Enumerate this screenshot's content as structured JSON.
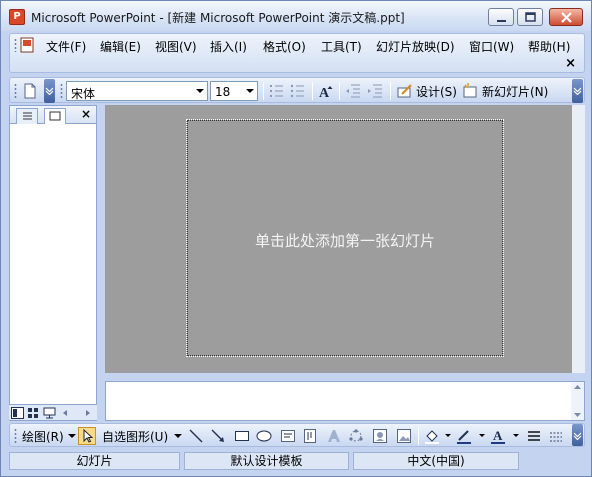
{
  "window": {
    "app_icon": "powerpoint-icon",
    "title": "Microsoft PowerPoint - [新建 Microsoft PowerPoint 演示文稿.ppt]"
  },
  "menu": {
    "items": [
      "文件(F)",
      "编辑(E)",
      "视图(V)",
      "插入(I)",
      "格式(O)",
      "工具(T)",
      "幻灯片放映(D)",
      "窗口(W)",
      "帮助(H)"
    ],
    "doc_close": "×"
  },
  "toolbar": {
    "font": "宋体",
    "font_size": "18",
    "design_label": "设计(S)",
    "new_slide_label": "新幻灯片(N)"
  },
  "leftpane": {
    "close": "×"
  },
  "slide": {
    "placeholder": "单击此处添加第一张幻灯片"
  },
  "drawbar": {
    "draw_label": "绘图(R)",
    "autoshapes_label": "自选图形(U)"
  },
  "status": {
    "cells": [
      "幻灯片",
      "默认设计模板",
      "中文(中国)"
    ]
  }
}
